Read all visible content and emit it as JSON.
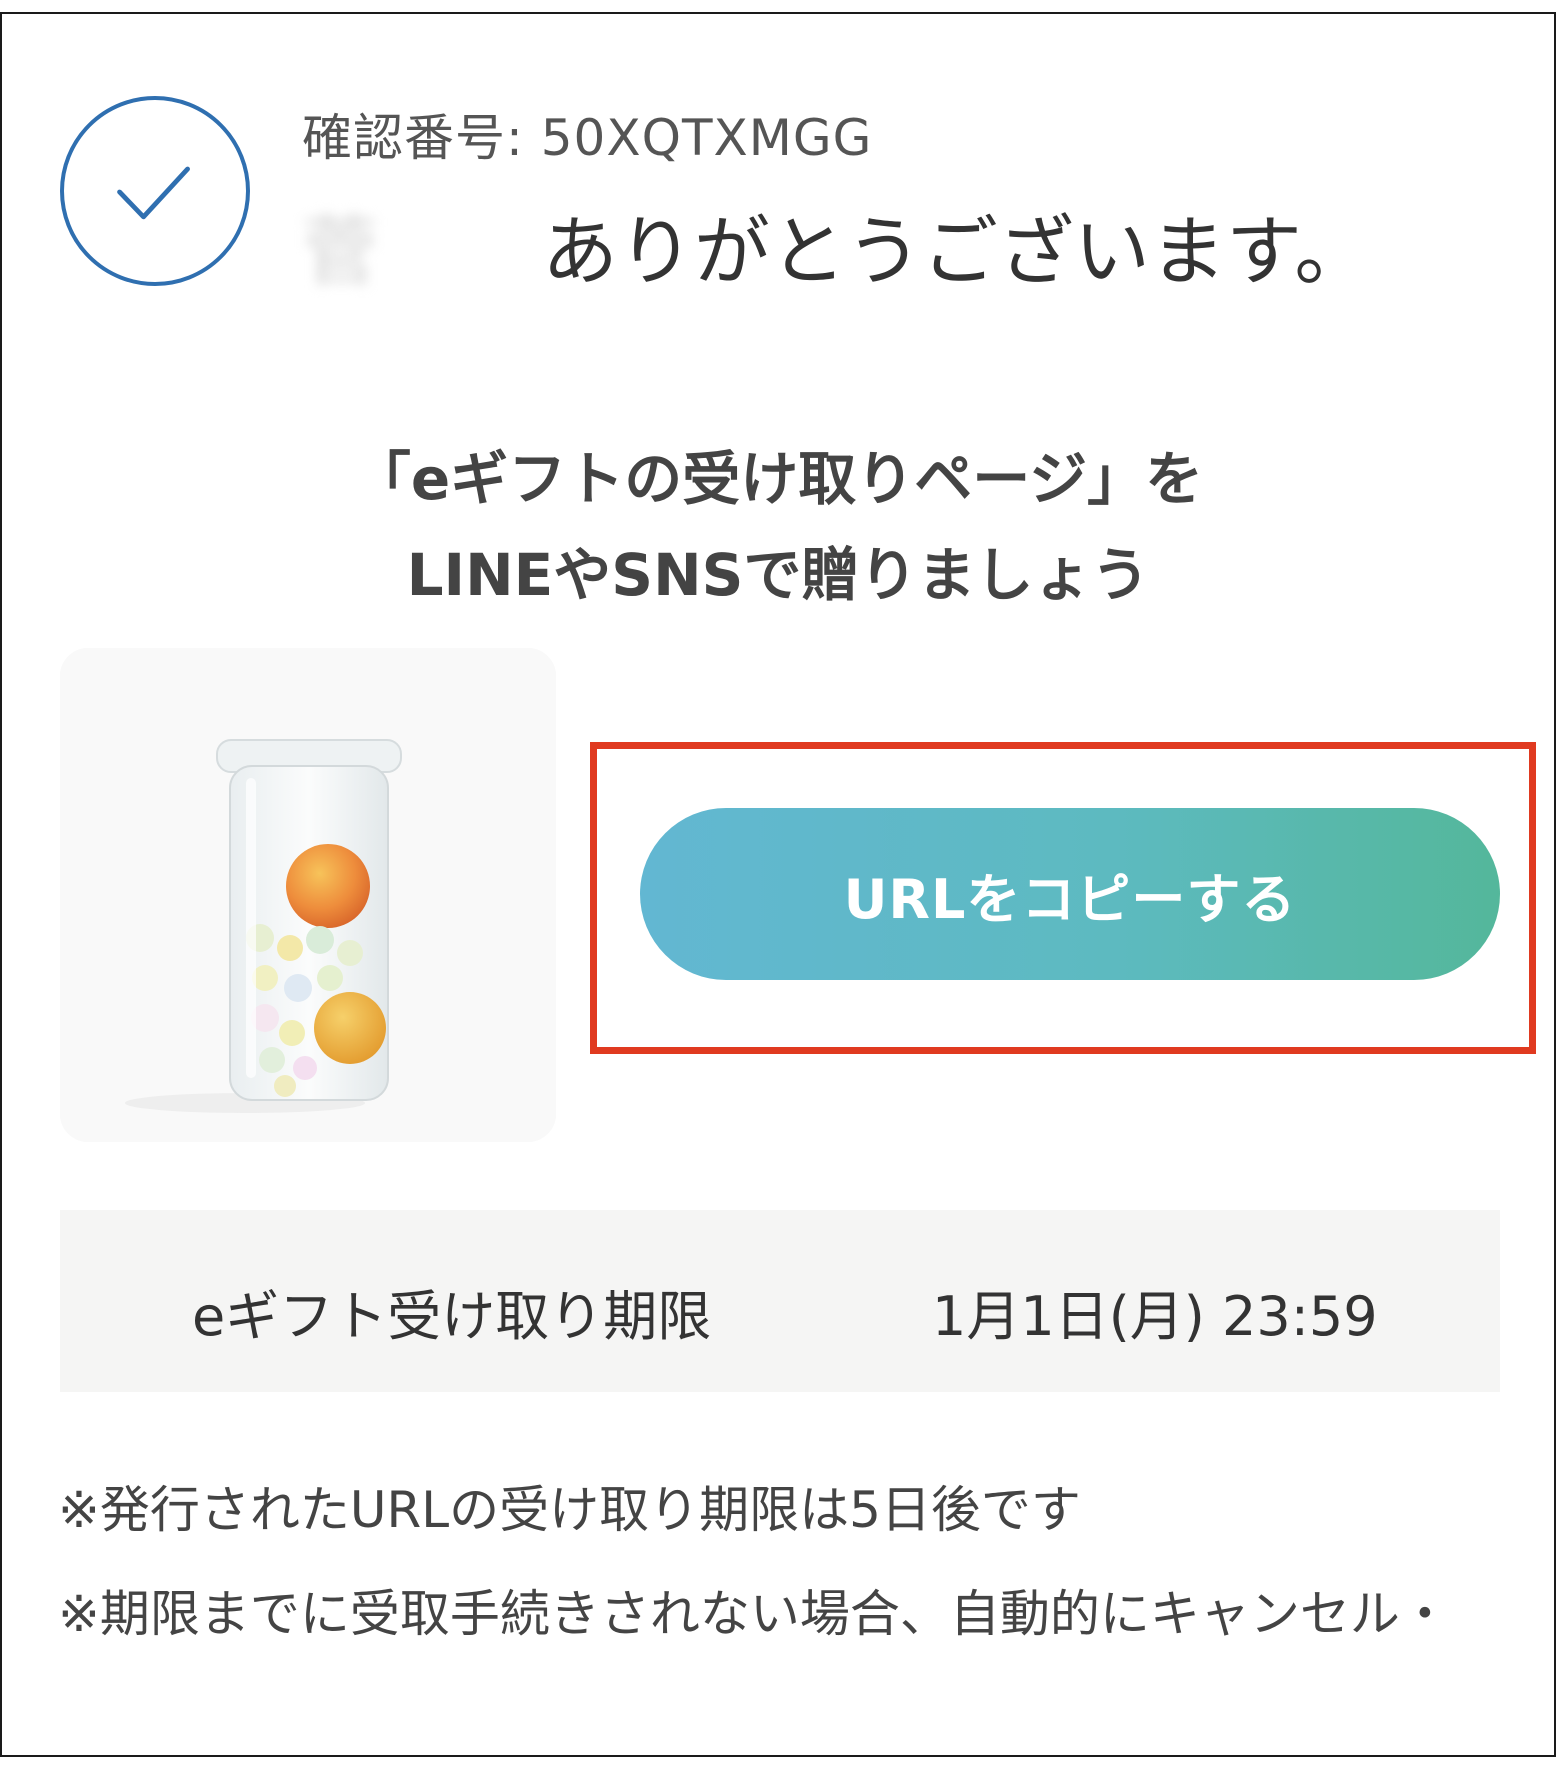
{
  "header": {
    "confirmation_label": "確認番号: 50XQTXMGG",
    "thanks_name_obscured": "菅",
    "thanks_message": "ありがとうございます。"
  },
  "share_prompt": {
    "line1": "「eギフトの受け取りページ」を",
    "line2": "LINEやSNSで贈りましょう"
  },
  "product": {
    "image": "gift-jar-photo"
  },
  "copy_button": {
    "label": "URLをコピーする",
    "highlight_color": "#e03a20",
    "gradient_start": "#62b7d2",
    "gradient_end": "#54b79b"
  },
  "deadline": {
    "label": "eギフト受け取り期限",
    "value": "1月1日(月) 23:59"
  },
  "notes": [
    "※発行されたURLの受け取り期限は5日後です",
    "※期限までに受取手続きされない場合、自動的にキャンセル・"
  ],
  "colors": {
    "check_icon": "#2f6fb0",
    "panel_background": "#f5f5f4"
  }
}
